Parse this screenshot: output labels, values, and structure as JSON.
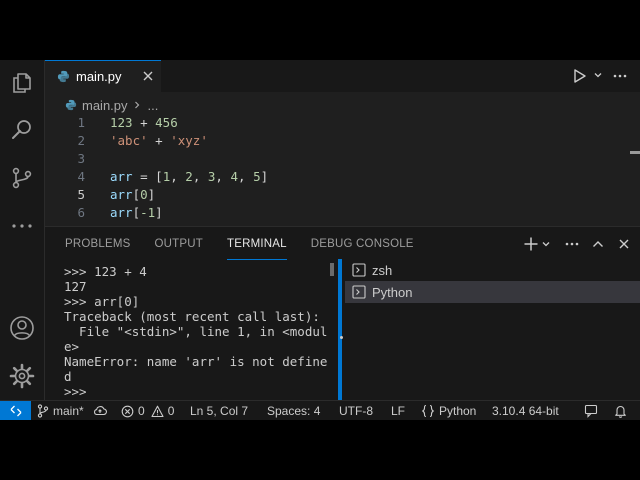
{
  "editor": {
    "tab": {
      "name": "main.py"
    },
    "breadcrumb": {
      "file": "main.py",
      "more": "..."
    },
    "lines": [
      {
        "no": "1",
        "tokens": [
          {
            "t": "123",
            "c": "num"
          },
          {
            "t": " + ",
            "c": "op"
          },
          {
            "t": "456",
            "c": "num"
          }
        ]
      },
      {
        "no": "2",
        "tokens": [
          {
            "t": "'abc'",
            "c": "str"
          },
          {
            "t": " + ",
            "c": "op"
          },
          {
            "t": "'xyz'",
            "c": "str"
          }
        ]
      },
      {
        "no": "3",
        "tokens": []
      },
      {
        "no": "4",
        "tokens": [
          {
            "t": "arr",
            "c": "var"
          },
          {
            "t": " = [",
            "c": "op"
          },
          {
            "t": "1",
            "c": "num"
          },
          {
            "t": ", ",
            "c": "op"
          },
          {
            "t": "2",
            "c": "num"
          },
          {
            "t": ", ",
            "c": "op"
          },
          {
            "t": "3",
            "c": "num"
          },
          {
            "t": ", ",
            "c": "op"
          },
          {
            "t": "4",
            "c": "num"
          },
          {
            "t": ", ",
            "c": "op"
          },
          {
            "t": "5",
            "c": "num"
          },
          {
            "t": "]",
            "c": "op"
          }
        ]
      },
      {
        "no": "5",
        "active": true,
        "tokens": [
          {
            "t": "arr",
            "c": "var"
          },
          {
            "t": "[",
            "c": "op"
          },
          {
            "t": "0",
            "c": "num"
          },
          {
            "t": "]",
            "c": "op"
          }
        ]
      },
      {
        "no": "6",
        "tokens": [
          {
            "t": "arr",
            "c": "var"
          },
          {
            "t": "[",
            "c": "op"
          },
          {
            "t": "-1",
            "c": "num"
          },
          {
            "t": "]",
            "c": "op"
          }
        ]
      }
    ]
  },
  "panel": {
    "tabs": [
      {
        "id": "problems",
        "label": "PROBLEMS"
      },
      {
        "id": "output",
        "label": "OUTPUT"
      },
      {
        "id": "terminal",
        "label": "TERMINAL",
        "active": true
      },
      {
        "id": "debug-console",
        "label": "DEBUG CONSOLE"
      }
    ],
    "terminal_lines": [
      ">>> 123 + 4",
      "127",
      ">>> arr[0]",
      "Traceback (most recent call last):",
      "  File \"<stdin>\", line 1, in <modul",
      "e>",
      "NameError: name 'arr' is not define",
      "d",
      ">>> "
    ],
    "terminals": [
      {
        "name": "zsh"
      },
      {
        "name": "Python",
        "selected": true
      }
    ]
  },
  "status": {
    "branch": "main*",
    "errors": "0",
    "warnings": "0",
    "position": "Ln 5, Col 7",
    "spaces": "Spaces: 4",
    "encoding": "UTF-8",
    "eol": "LF",
    "language": "Python",
    "interpreter": "3.10.4 64-bit"
  },
  "colors": {
    "accent": "#0078d4",
    "background": "#1f1f1f",
    "panel": "#181818",
    "python_icon": "#519aba"
  },
  "icons": [
    "explorer-icon",
    "search-icon",
    "source-control-icon",
    "more-icon",
    "account-icon",
    "gear-icon",
    "python-file-icon",
    "close-icon",
    "run-icon",
    "chevron-down-icon",
    "plus-icon",
    "chevron-up-icon",
    "terminal-icon",
    "remote-icon",
    "branch-icon",
    "sync-icon",
    "error-icon",
    "warning-icon",
    "braces-icon",
    "feedback-icon",
    "bell-icon"
  ]
}
